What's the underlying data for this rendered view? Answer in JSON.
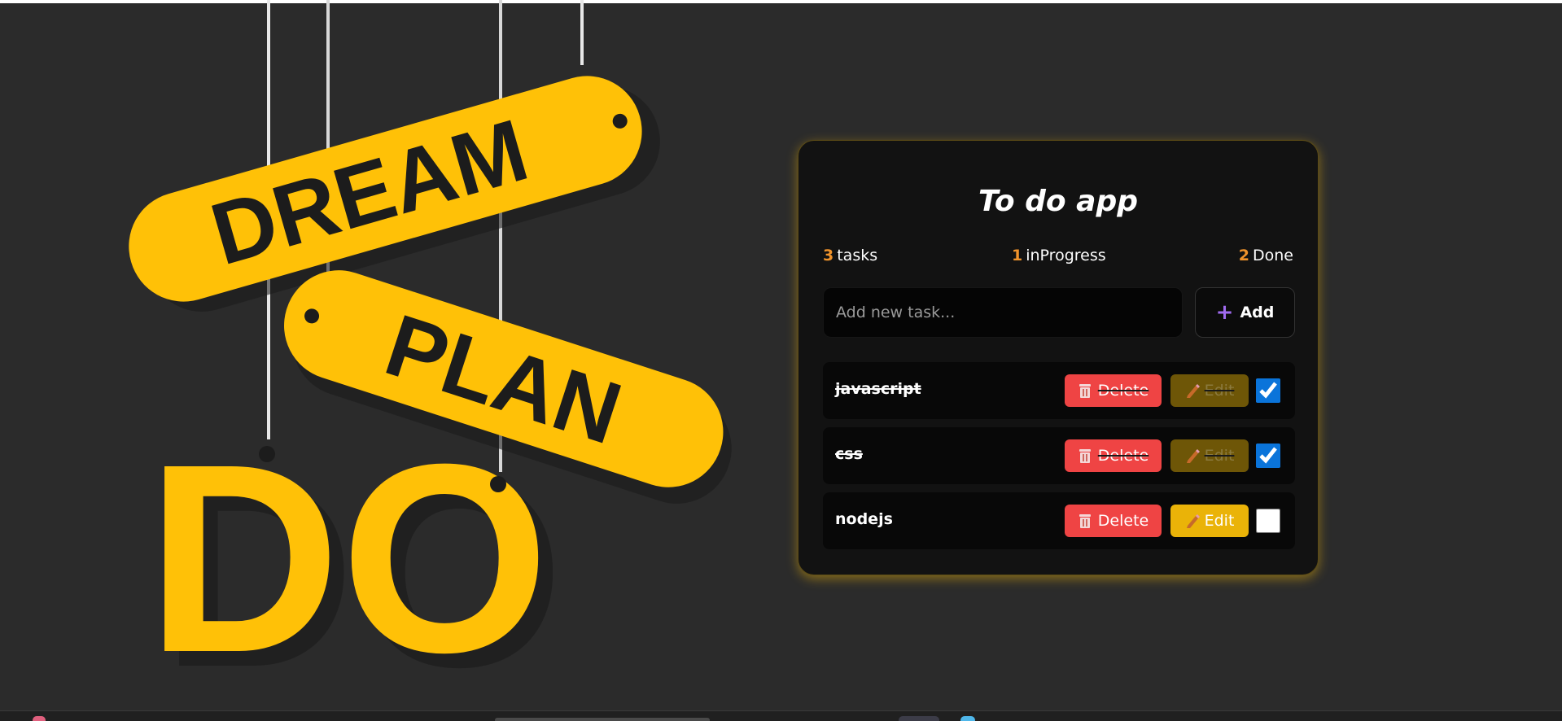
{
  "app": {
    "title": "To do app"
  },
  "hero": {
    "words": [
      "DREAM",
      "PLAN",
      "DO"
    ],
    "colors": {
      "tag": "#ffc107",
      "letters": "#1c1c1c",
      "background": "#2b2b2b"
    }
  },
  "stats": {
    "tasks": {
      "count": "3",
      "label": "tasks"
    },
    "in_progress": {
      "count": "1",
      "label": "inProgress"
    },
    "done": {
      "count": "2",
      "label": "Done"
    }
  },
  "new_task": {
    "placeholder": "Add new task...",
    "value": "",
    "add_label": "Add",
    "add_icon": "plus-icon"
  },
  "tasks": [
    {
      "name": "javascript",
      "done": true,
      "delete_label": "Delete",
      "edit_label": "Edit"
    },
    {
      "name": "css",
      "done": true,
      "delete_label": "Delete",
      "edit_label": "Edit"
    },
    {
      "name": "nodejs",
      "done": false,
      "delete_label": "Delete",
      "edit_label": "Edit"
    }
  ],
  "colors": {
    "accent": "#f0932b",
    "delete": "#ef4444",
    "edit": "#eab308",
    "checkbox": "#0a74da",
    "card_glow": "#ffc107"
  }
}
